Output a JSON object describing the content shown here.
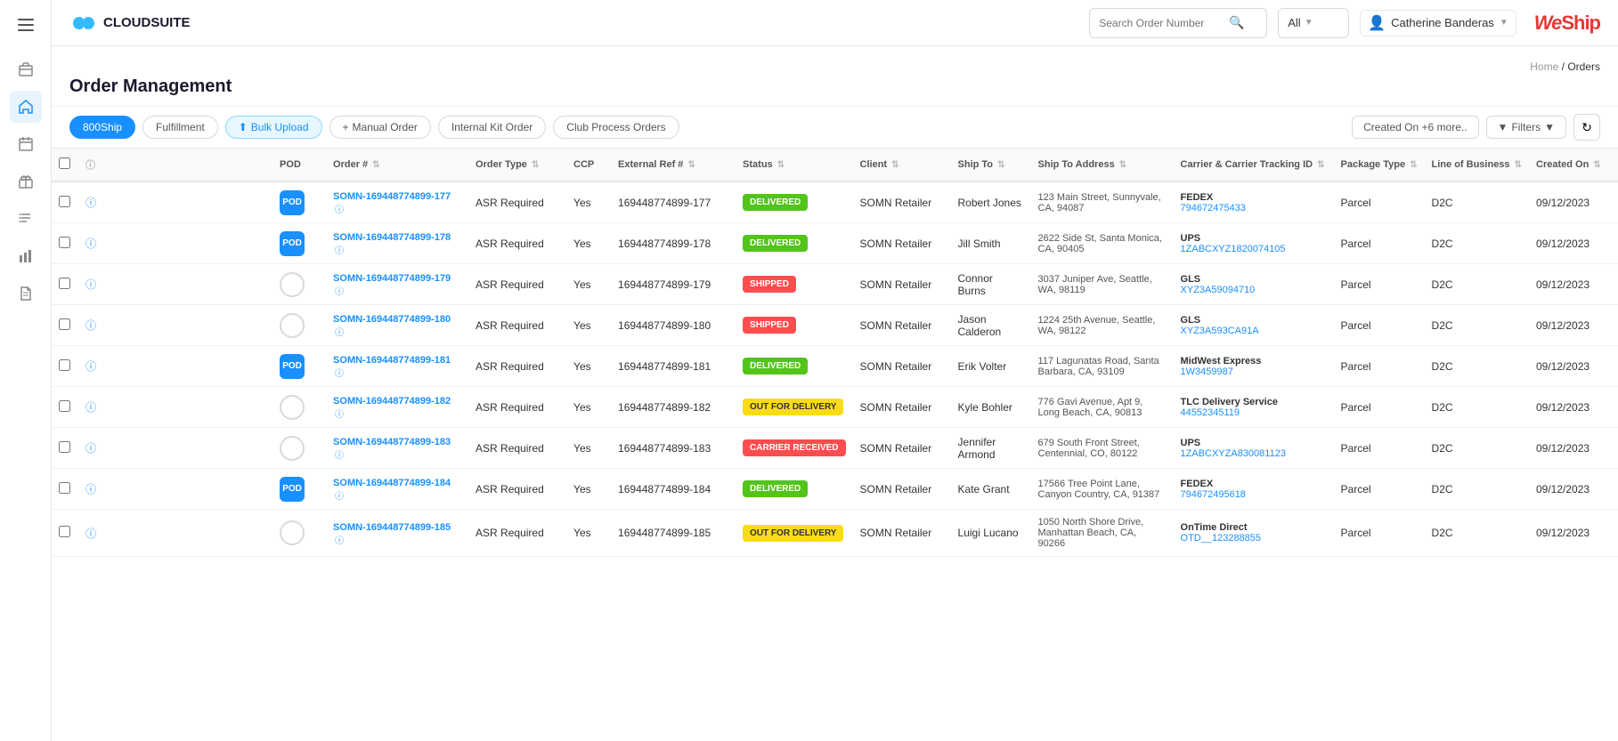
{
  "app": {
    "logo_text": "CLOUDSUITE",
    "weship_logo": "WéShip"
  },
  "topbar": {
    "search_placeholder": "Search Order Number",
    "filter_label": "All",
    "user_name": "Catherine Banderas"
  },
  "breadcrumb": {
    "home": "Home",
    "separator": "/",
    "current": "Orders"
  },
  "page": {
    "title": "Order Management"
  },
  "tabs": [
    {
      "id": "800ship",
      "label": "800Ship",
      "active": true
    },
    {
      "id": "fulfillment",
      "label": "Fulfillment",
      "active": false
    },
    {
      "id": "bulk-upload",
      "label": "Bulk Upload",
      "active": false,
      "icon": "upload"
    },
    {
      "id": "manual-order",
      "label": "Manual Order",
      "active": false,
      "icon": "plus"
    },
    {
      "id": "internal-kit",
      "label": "Internal Kit Order",
      "active": false
    },
    {
      "id": "club-process",
      "label": "Club Process Orders",
      "active": false
    }
  ],
  "toolbar": {
    "created_on": "Created On",
    "plus_more": "+6 more..",
    "filters": "Filters",
    "filter_icon": "▼"
  },
  "table": {
    "columns": [
      "",
      "POD",
      "Order #",
      "Order Type",
      "CCP",
      "External Ref #",
      "Status",
      "Client",
      "Ship To",
      "Ship To Address",
      "Carrier & Carrier Tracking ID",
      "Package Type",
      "Line of Business",
      "Created On"
    ],
    "rows": [
      {
        "id": 1,
        "pod": "pod",
        "order_num": "SOMN-169448774899-177",
        "order_info": "ⓘ",
        "order_type": "ASR Required",
        "ccp": "Yes",
        "ext_ref": "169448774899-177",
        "status": "DELIVERED",
        "status_type": "delivered",
        "client": "SOMN Retailer",
        "ship_to": "Robert Jones",
        "ship_address": "123 Main Street, Sunnyvale, CA, 94087",
        "carrier": "FEDEX",
        "tracking_id": "794672475433",
        "pkg_type": "Parcel",
        "lob": "D2C",
        "created_on": "09/12/2023"
      },
      {
        "id": 2,
        "pod": "pod",
        "order_num": "SOMN-169448774899-178",
        "order_info": "ⓘ",
        "order_type": "ASR Required",
        "ccp": "Yes",
        "ext_ref": "169448774899-178",
        "status": "DELIVERED",
        "status_type": "delivered",
        "client": "SOMN Retailer",
        "ship_to": "Jill Smith",
        "ship_address": "2622 Side St, Santa Monica, CA, 90405",
        "carrier": "UPS",
        "tracking_id": "1ZABCXYZ1820074105",
        "pkg_type": "Parcel",
        "lob": "D2C",
        "created_on": "09/12/2023"
      },
      {
        "id": 3,
        "pod": "-",
        "order_num": "SOMN-169448774899-179",
        "order_info": "ⓘ",
        "order_type": "ASR Required",
        "ccp": "Yes",
        "ext_ref": "169448774899-179",
        "status": "SHIPPED",
        "status_type": "shipped",
        "client": "SOMN Retailer",
        "ship_to": "Connor Burns",
        "ship_address": "3037 Juniper Ave, Seattle, WA, 98119",
        "carrier": "GLS",
        "tracking_id": "XYZ3A59094710",
        "pkg_type": "Parcel",
        "lob": "D2C",
        "created_on": "09/12/2023"
      },
      {
        "id": 4,
        "pod": "-",
        "order_num": "SOMN-169448774899-180",
        "order_info": "ⓘ",
        "order_type": "ASR Required",
        "ccp": "Yes",
        "ext_ref": "169448774899-180",
        "status": "SHIPPED",
        "status_type": "shipped",
        "client": "SOMN Retailer",
        "ship_to": "Jason Calderon",
        "ship_address": "1224 25th Avenue, Seattle, WA, 98122",
        "carrier": "GLS",
        "tracking_id": "XYZ3A593CA91A",
        "pkg_type": "Parcel",
        "lob": "D2C",
        "created_on": "09/12/2023"
      },
      {
        "id": 5,
        "pod": "pod",
        "order_num": "SOMN-169448774899-181",
        "order_info": "ⓘ",
        "order_type": "ASR Required",
        "ccp": "Yes",
        "ext_ref": "169448774899-181",
        "status": "DELIVERED",
        "status_type": "delivered",
        "client": "SOMN Retailer",
        "ship_to": "Erik Volter",
        "ship_address": "117 Lagunatas Road, Santa Barbara, CA, 93109",
        "carrier": "MidWest Express",
        "tracking_id": "1W3459987",
        "pkg_type": "Parcel",
        "lob": "D2C",
        "created_on": "09/12/2023"
      },
      {
        "id": 6,
        "pod": "-",
        "order_num": "SOMN-169448774899-182",
        "order_info": "ⓘ",
        "order_type": "ASR Required",
        "ccp": "Yes",
        "ext_ref": "169448774899-182",
        "status": "OUT FOR DELIVERY",
        "status_type": "out-for-delivery",
        "client": "SOMN Retailer",
        "ship_to": "Kyle Bohler",
        "ship_address": "776 Gavi Avenue, Apt 9, Long Beach, CA, 90813",
        "carrier": "TLC Delivery Service",
        "tracking_id": "44552345119",
        "pkg_type": "Parcel",
        "lob": "D2C",
        "created_on": "09/12/2023"
      },
      {
        "id": 7,
        "pod": "-",
        "order_num": "SOMN-169448774899-183",
        "order_info": "ⓘ",
        "order_type": "ASR Required",
        "ccp": "Yes",
        "ext_ref": "169448774899-183",
        "status": "CARRIER RECEIVED",
        "status_type": "carrier-received",
        "client": "SOMN Retailer",
        "ship_to": "Jennifer Armond",
        "ship_address": "679 South Front Street, Centennial, CO, 80122",
        "carrier": "UPS",
        "tracking_id": "1ZABCXYZA830081123",
        "pkg_type": "Parcel",
        "lob": "D2C",
        "created_on": "09/12/2023"
      },
      {
        "id": 8,
        "pod": "pod",
        "order_num": "SOMN-169448774899-184",
        "order_info": "ⓘ",
        "order_type": "ASR Required",
        "ccp": "Yes",
        "ext_ref": "169448774899-184",
        "status": "DELIVERED",
        "status_type": "delivered",
        "client": "SOMN Retailer",
        "ship_to": "Kate Grant",
        "ship_address": "17566 Tree Point Lane, Canyon Country, CA, 91387",
        "carrier": "FEDEX",
        "tracking_id": "794672495618",
        "pkg_type": "Parcel",
        "lob": "D2C",
        "created_on": "09/12/2023"
      },
      {
        "id": 9,
        "pod": "-",
        "order_num": "SOMN-169448774899-185",
        "order_info": "ⓘ",
        "order_type": "ASR Required",
        "ccp": "Yes",
        "ext_ref": "169448774899-185",
        "status": "OUT FOR DELIVERY",
        "status_type": "out-for-delivery",
        "client": "SOMN Retailer",
        "ship_to": "Luigi Lucano",
        "ship_address": "1050 North Shore Drive, Manhattan Beach, CA, 90266",
        "carrier": "OnTime Direct",
        "tracking_id": "OTD__123288855",
        "pkg_type": "Parcel",
        "lob": "D2C",
        "created_on": "09/12/2023"
      }
    ]
  },
  "sidebar": {
    "icons": [
      "☰",
      "📦",
      "🏠",
      "📅",
      "🎁",
      "📋",
      "📊",
      "📝"
    ]
  }
}
